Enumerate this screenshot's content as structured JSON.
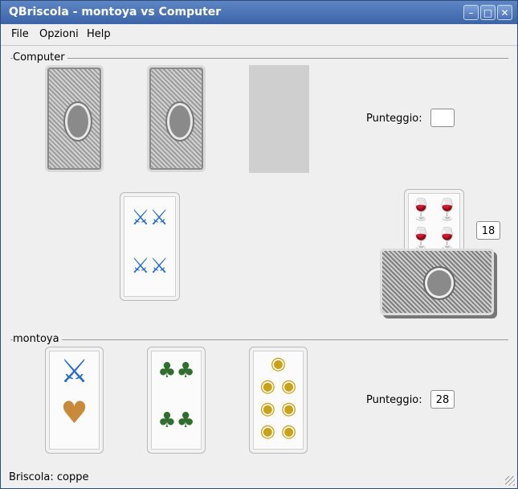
{
  "window": {
    "title": "QBriscola - montoya vs Computer",
    "controls": [
      "minimize-icon",
      "maximize-icon",
      "close-icon"
    ]
  },
  "menu": {
    "items": [
      "File",
      "Opzioni",
      "Help"
    ]
  },
  "computer": {
    "group_label": "Computer",
    "score_label": "Punteggio:",
    "score_value": "",
    "cards": [
      "card-back",
      "card-back",
      "empty-slot"
    ]
  },
  "table": {
    "played_card": "4 di spade",
    "briscola_card": "4 di coppe",
    "deck_count": "18"
  },
  "player": {
    "group_label": "montoya",
    "score_label": "Punteggio:",
    "score_value": "28",
    "cards": [
      "asso di spade",
      "4 di bastoni",
      "7 di denari"
    ]
  },
  "status": {
    "text": "Briscola: coppe"
  },
  "colors": {
    "titlebar": "#4a70b3",
    "window_bg": "#efefef"
  }
}
